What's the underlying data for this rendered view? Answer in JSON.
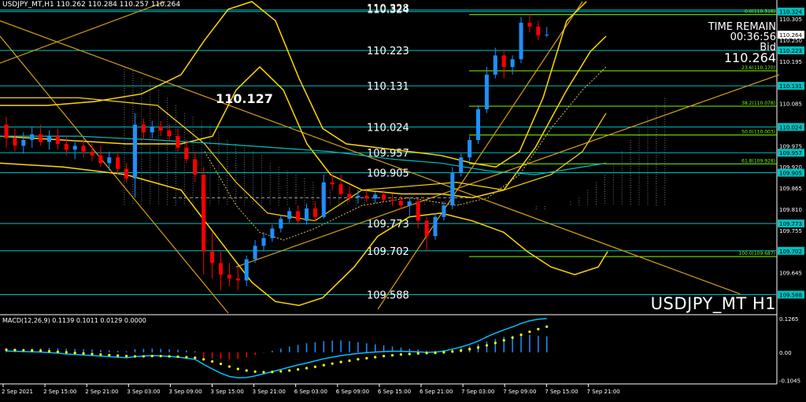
{
  "header": {
    "symbol_tf": "USDJPY_MT,H1",
    "ohlc": "110.262 110.284 110.257 110.264"
  },
  "info": {
    "time_label": "TIME REMAIN",
    "time_value": "00:36:56",
    "bid_label": "Bid",
    "bid_value": "110.264"
  },
  "symbol_label": "USDJPY_MT H1",
  "big_label": "110.127",
  "macd_header": "MACD(12,26,9) 0.1139 0.1011 0.0129 0.0000",
  "colors": {
    "bull": "#1e90ff",
    "bear": "#ff0000",
    "level": "#00c0c0",
    "fib": "#7cfc00",
    "envelope": "#ffd700",
    "cloud": "#c8c8c8",
    "signal": "#ffff00",
    "macd_line": "#00bfff"
  },
  "chart_data": {
    "type": "candlestick",
    "ylim": [
      109.54,
      110.35
    ],
    "price_axis_labels": [
      "110.324",
      "110.305",
      "110.250",
      "110.223",
      "110.195",
      "110.131",
      "110.085",
      "110.024",
      "109.975",
      "109.957",
      "109.920",
      "109.905",
      "109.865",
      "109.810",
      "109.773",
      "109.755",
      "109.702",
      "109.645",
      "109.588"
    ],
    "level_lines": [
      110.328,
      110.324,
      110.223,
      110.131,
      110.024,
      109.957,
      109.905,
      109.773,
      109.702,
      109.588
    ],
    "level_text": [
      {
        "text": "110.328",
        "y": 110.328
      },
      {
        "text": "110.324",
        "y": 110.324
      },
      {
        "text": "110.223",
        "y": 110.223
      },
      {
        "text": "110.131",
        "y": 110.131
      },
      {
        "text": "110.024",
        "y": 110.024
      },
      {
        "text": "109.957",
        "y": 109.957
      },
      {
        "text": "109.905",
        "y": 109.905
      },
      {
        "text": "109.773",
        "y": 109.773
      },
      {
        "text": "109.702",
        "y": 109.702
      },
      {
        "text": "109.588",
        "y": 109.588
      }
    ],
    "fib_levels": [
      {
        "label": "0.0(110.316)",
        "y": 110.316
      },
      {
        "label": "23.6(110.170)",
        "y": 110.17
      },
      {
        "label": "38.2(110.078)",
        "y": 110.078
      },
      {
        "label": "50.0(110.003)",
        "y": 110.003
      },
      {
        "label": "61.8(109.928)",
        "y": 109.928
      },
      {
        "label": "100.0(109.687)",
        "y": 109.687
      }
    ],
    "x_labels": [
      "2 Sep 2021",
      "2 Sep 15:00",
      "2 Sep 21:00",
      "3 Sep 03:00",
      "3 Sep 09:00",
      "3 Sep 15:00",
      "3 Sep 21:00",
      "6 Sep 03:00",
      "6 Sep 09:00",
      "6 Sep 15:00",
      "6 Sep 21:00",
      "7 Sep 03:00",
      "7 Sep 09:00",
      "7 Sep 15:00",
      "7 Sep 21:00"
    ],
    "candles": [
      [
        110.03,
        110.05,
        109.97,
        109.995
      ],
      [
        109.995,
        110.02,
        109.96,
        109.975
      ],
      [
        109.975,
        110.01,
        109.955,
        109.99
      ],
      [
        109.99,
        110.025,
        109.97,
        110.005
      ],
      [
        110.005,
        110.03,
        109.975,
        109.985
      ],
      [
        109.985,
        110.015,
        109.965,
        110.0
      ],
      [
        110.0,
        110.02,
        109.965,
        109.98
      ],
      [
        109.98,
        110.0,
        109.95,
        109.965
      ],
      [
        109.965,
        109.99,
        109.94,
        109.975
      ],
      [
        109.975,
        109.995,
        109.945,
        109.96
      ],
      [
        109.96,
        109.98,
        109.935,
        109.95
      ],
      [
        109.95,
        109.975,
        109.92,
        109.93
      ],
      [
        109.93,
        109.96,
        109.91,
        109.945
      ],
      [
        109.945,
        109.96,
        109.9,
        109.915
      ],
      [
        109.915,
        109.93,
        109.88,
        109.89
      ],
      [
        109.89,
        110.06,
        109.84,
        110.03
      ],
      [
        110.03,
        110.045,
        109.99,
        110.01
      ],
      [
        110.01,
        110.04,
        109.995,
        110.025
      ],
      [
        110.025,
        110.04,
        110.0,
        110.015
      ],
      [
        110.015,
        110.03,
        109.99,
        110.0
      ],
      [
        110.0,
        110.02,
        109.96,
        109.97
      ],
      [
        109.97,
        109.99,
        109.93,
        109.94
      ],
      [
        109.94,
        109.96,
        109.88,
        109.9
      ],
      [
        109.9,
        109.92,
        109.64,
        109.7
      ],
      [
        109.7,
        109.75,
        109.63,
        109.67
      ],
      [
        109.67,
        109.7,
        109.6,
        109.64
      ],
      [
        109.64,
        109.67,
        109.61,
        109.63
      ],
      [
        109.63,
        109.66,
        109.6,
        109.625
      ],
      [
        109.625,
        109.69,
        109.61,
        109.68
      ],
      [
        109.68,
        109.73,
        109.67,
        109.715
      ],
      [
        109.715,
        109.75,
        109.7,
        109.735
      ],
      [
        109.735,
        109.77,
        109.725,
        109.76
      ],
      [
        109.76,
        109.795,
        109.75,
        109.785
      ],
      [
        109.785,
        109.815,
        109.775,
        109.805
      ],
      [
        109.805,
        109.82,
        109.77,
        109.78
      ],
      [
        109.78,
        109.825,
        109.77,
        109.812
      ],
      [
        109.812,
        109.83,
        109.78,
        109.79
      ],
      [
        109.79,
        109.9,
        109.785,
        109.88
      ],
      [
        109.88,
        109.905,
        109.86,
        109.875
      ],
      [
        109.875,
        109.9,
        109.845,
        109.85
      ],
      [
        109.85,
        109.87,
        109.83,
        109.84
      ],
      [
        109.84,
        109.86,
        109.825,
        109.845
      ],
      [
        109.845,
        109.86,
        109.83,
        109.838
      ],
      [
        109.838,
        109.855,
        109.826,
        109.848
      ],
      [
        109.848,
        109.86,
        109.83,
        109.835
      ],
      [
        109.835,
        109.85,
        109.818,
        109.832
      ],
      [
        109.832,
        109.845,
        109.81,
        109.82
      ],
      [
        109.82,
        109.84,
        109.79,
        109.83
      ],
      [
        109.83,
        109.84,
        109.76,
        109.78
      ],
      [
        109.78,
        109.79,
        109.7,
        109.74
      ],
      [
        109.74,
        109.8,
        109.73,
        109.79
      ],
      [
        109.79,
        109.83,
        109.78,
        109.82
      ],
      [
        109.82,
        109.92,
        109.81,
        109.905
      ],
      [
        109.905,
        109.955,
        109.895,
        109.945
      ],
      [
        109.945,
        110.0,
        109.935,
        109.99
      ],
      [
        109.99,
        110.08,
        109.98,
        110.07
      ],
      [
        110.07,
        110.18,
        110.06,
        110.16
      ],
      [
        110.16,
        110.23,
        110.15,
        110.21
      ],
      [
        110.21,
        110.225,
        110.15,
        110.18
      ],
      [
        110.18,
        110.21,
        110.16,
        110.2
      ],
      [
        110.2,
        110.31,
        110.19,
        110.295
      ],
      [
        110.295,
        110.316,
        110.27,
        110.285
      ],
      [
        110.285,
        110.3,
        110.25,
        110.262
      ],
      [
        110.262,
        110.284,
        110.257,
        110.264
      ]
    ],
    "macd_axis_labels": [
      "0.1265",
      "0.00",
      "-0.1045"
    ],
    "macd_ylim": [
      -0.115,
      0.135
    ],
    "macd_hist": [
      0.008,
      0.01,
      0.012,
      0.014,
      0.015,
      0.016,
      0.015,
      0.014,
      0.013,
      0.012,
      0.011,
      0.009,
      0.007,
      0.006,
      0.004,
      0.012,
      0.013,
      0.014,
      0.013,
      0.012,
      0.01,
      0.007,
      0.004,
      -0.02,
      -0.022,
      -0.025,
      -0.026,
      -0.024,
      -0.018,
      -0.01,
      -0.002,
      0.006,
      0.014,
      0.022,
      0.028,
      0.034,
      0.038,
      0.042,
      0.044,
      0.045,
      0.042,
      0.038,
      0.034,
      0.03,
      0.026,
      0.022,
      0.018,
      0.014,
      0.01,
      0.006,
      0.006,
      0.008,
      0.012,
      0.016,
      0.022,
      0.03,
      0.04,
      0.05,
      0.058,
      0.062,
      0.068,
      0.066,
      0.062,
      0.06
    ],
    "macd_line": [
      0.005,
      0.004,
      0.003,
      0.002,
      0.001,
      -0.001,
      -0.003,
      -0.006,
      -0.008,
      -0.01,
      -0.012,
      -0.014,
      -0.016,
      -0.018,
      -0.02,
      -0.016,
      -0.014,
      -0.012,
      -0.013,
      -0.015,
      -0.018,
      -0.022,
      -0.026,
      -0.045,
      -0.062,
      -0.078,
      -0.09,
      -0.095,
      -0.094,
      -0.088,
      -0.08,
      -0.072,
      -0.064,
      -0.055,
      -0.047,
      -0.04,
      -0.032,
      -0.024,
      -0.018,
      -0.012,
      -0.008,
      -0.004,
      -0.001,
      0.001,
      0.003,
      0.004,
      0.004,
      0.003,
      0.002,
      0.0,
      0.001,
      0.005,
      0.012,
      0.02,
      0.03,
      0.042,
      0.058,
      0.072,
      0.084,
      0.095,
      0.108,
      0.118,
      0.124,
      0.126
    ],
    "signal_line": [
      0.01,
      0.009,
      0.008,
      0.007,
      0.006,
      0.004,
      0.002,
      0.0,
      -0.002,
      -0.004,
      -0.006,
      -0.008,
      -0.01,
      -0.012,
      -0.014,
      -0.015,
      -0.015,
      -0.014,
      -0.014,
      -0.015,
      -0.016,
      -0.018,
      -0.02,
      -0.026,
      -0.034,
      -0.043,
      -0.053,
      -0.062,
      -0.068,
      -0.072,
      -0.074,
      -0.073,
      -0.071,
      -0.068,
      -0.064,
      -0.059,
      -0.054,
      -0.048,
      -0.042,
      -0.036,
      -0.031,
      -0.026,
      -0.022,
      -0.018,
      -0.014,
      -0.011,
      -0.008,
      -0.006,
      -0.004,
      -0.003,
      -0.002,
      0.0,
      0.003,
      0.007,
      0.012,
      0.018,
      0.026,
      0.035,
      0.045,
      0.055,
      0.066,
      0.077,
      0.087,
      0.096
    ]
  }
}
